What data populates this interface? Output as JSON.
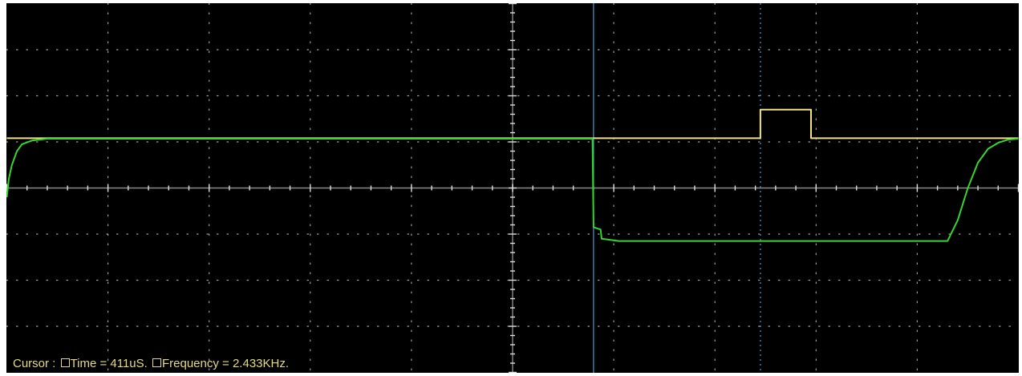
{
  "readout": {
    "prefix": "Cursor :",
    "time_label": "Time = 411uS.",
    "frequency_label": "Frequency = 2.433KHz."
  },
  "colors": {
    "background": "#000000",
    "grid": "#bbbbbb",
    "yellow_trace": "#f2e27a",
    "green_trace": "#35d62e",
    "cursor": "#3f9fd8",
    "readout_text": "#e4d98a"
  },
  "icons": [
    "checkbox-icon",
    "checkbox-icon"
  ],
  "chart_data": {
    "type": "line",
    "grid": true,
    "divisions": {
      "x": 10,
      "y": 8
    },
    "xlim": [
      0,
      10
    ],
    "ylim": [
      -4,
      4
    ],
    "cursors": [
      {
        "name": "cursor-1",
        "x": 5.8,
        "style": "solid"
      },
      {
        "name": "cursor-2",
        "x": 7.45,
        "style": "dashed"
      }
    ],
    "series": [
      {
        "color": "yellow",
        "x": [
          0.0,
          0.05,
          0.1,
          0.2,
          0.3,
          0.5,
          1.0,
          3.0,
          5.0,
          5.8,
          7.4,
          7.45,
          7.45,
          7.95,
          7.95,
          8.05,
          9.0,
          10.0
        ],
        "y": [
          1.08,
          1.08,
          1.08,
          1.08,
          1.08,
          1.08,
          1.08,
          1.08,
          1.08,
          1.08,
          1.08,
          1.08,
          1.7,
          1.7,
          1.08,
          1.08,
          1.08,
          1.08
        ]
      },
      {
        "color": "green",
        "x": [
          0.0,
          0.02,
          0.05,
          0.1,
          0.15,
          0.25,
          0.4,
          0.6,
          3.0,
          5.0,
          5.79,
          5.8,
          5.87,
          5.88,
          6.05,
          8.4,
          9.3,
          9.4,
          9.5,
          9.6,
          9.7,
          9.8,
          9.9,
          10.0
        ],
        "y": [
          -0.2,
          0.2,
          0.5,
          0.8,
          0.95,
          1.03,
          1.07,
          1.07,
          1.07,
          1.07,
          1.07,
          -0.85,
          -0.9,
          -1.1,
          -1.15,
          -1.15,
          -1.15,
          -0.7,
          0.0,
          0.55,
          0.85,
          0.98,
          1.05,
          1.07
        ]
      }
    ]
  }
}
